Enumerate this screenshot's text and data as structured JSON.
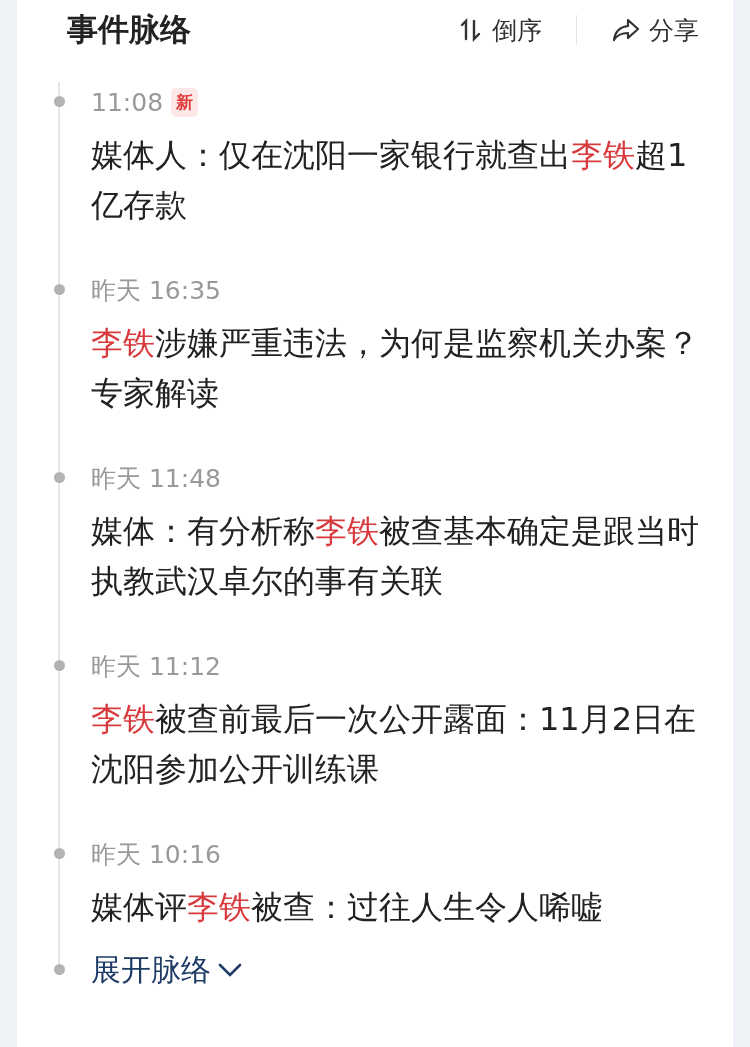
{
  "header": {
    "title": "事件脉络",
    "sort_label": "倒序",
    "share_label": "分享"
  },
  "events": [
    {
      "time": "11:08",
      "badge": "新",
      "headline": [
        {
          "text": "媒体人：仅在沈阳一家银行就查出",
          "highlight": false
        },
        {
          "text": "李铁",
          "highlight": true
        },
        {
          "text": "超1亿存款",
          "highlight": false
        }
      ]
    },
    {
      "time": "昨天 16:35",
      "headline": [
        {
          "text": "李铁",
          "highlight": true
        },
        {
          "text": "涉嫌严重违法，为何是监察机关办案？专家解读",
          "highlight": false
        }
      ]
    },
    {
      "time": "昨天 11:48",
      "headline": [
        {
          "text": "媒体：有分析称",
          "highlight": false
        },
        {
          "text": "李铁",
          "highlight": true
        },
        {
          "text": "被查基本确定是跟当时执教武汉卓尔的事有关联",
          "highlight": false
        }
      ]
    },
    {
      "time": "昨天 11:12",
      "headline": [
        {
          "text": "李铁",
          "highlight": true
        },
        {
          "text": "被查前最后一次公开露面：11月2日在沈阳参加公开训练课",
          "highlight": false
        }
      ]
    },
    {
      "time": "昨天 10:16",
      "headline": [
        {
          "text": "媒体评",
          "highlight": false
        },
        {
          "text": "李铁",
          "highlight": true
        },
        {
          "text": "被查：过往人生令人唏嘘",
          "highlight": false
        }
      ]
    }
  ],
  "expand": {
    "label": "展开脉络",
    "expanded": false
  }
}
